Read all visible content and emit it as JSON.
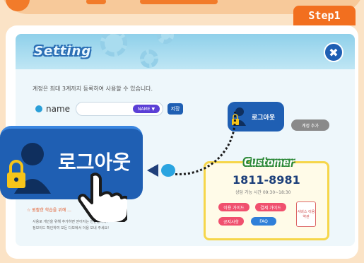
{
  "step": {
    "label": "Step1"
  },
  "dialog": {
    "title": "Setting",
    "close_icon": "close-icon",
    "description": "계정은 최대 3계까지 등록하여 사용할 수 있습니다.",
    "name_field": {
      "label": "name",
      "chip": "NAME ▼",
      "save_label": "저장"
    },
    "small_logout_label": "로그아웃",
    "small_grey_label": "계정 추가",
    "bottom_text_1": "사용로 개인을 위해 추가하면 얻어지는 인원합니다.",
    "bottom_text_2": "정보이드 확인하여 모든 다보에서 이용 보내 주세요!",
    "warn_text": "☆ 원활한 학습을 위해 ..."
  },
  "big_logout": {
    "label": "로그아웃"
  },
  "customer": {
    "title": "Customer",
    "phone": "1811-8981",
    "hours": "상담 가능 시간 09:30~18:30",
    "buttons": [
      {
        "label": "이용 가이드",
        "color": "#f0506e"
      },
      {
        "label": "결제 가이드",
        "color": "#f0506e"
      },
      {
        "label": "공지사항",
        "color": "#f0506e"
      },
      {
        "label": "FAQ",
        "color": "#2f7fd9"
      }
    ],
    "memo": "서비스 이용 약관"
  },
  "colors": {
    "accent": "#f26f1f",
    "primary_blue": "#1f5fb3",
    "panel_bg": "#eef7fb"
  }
}
